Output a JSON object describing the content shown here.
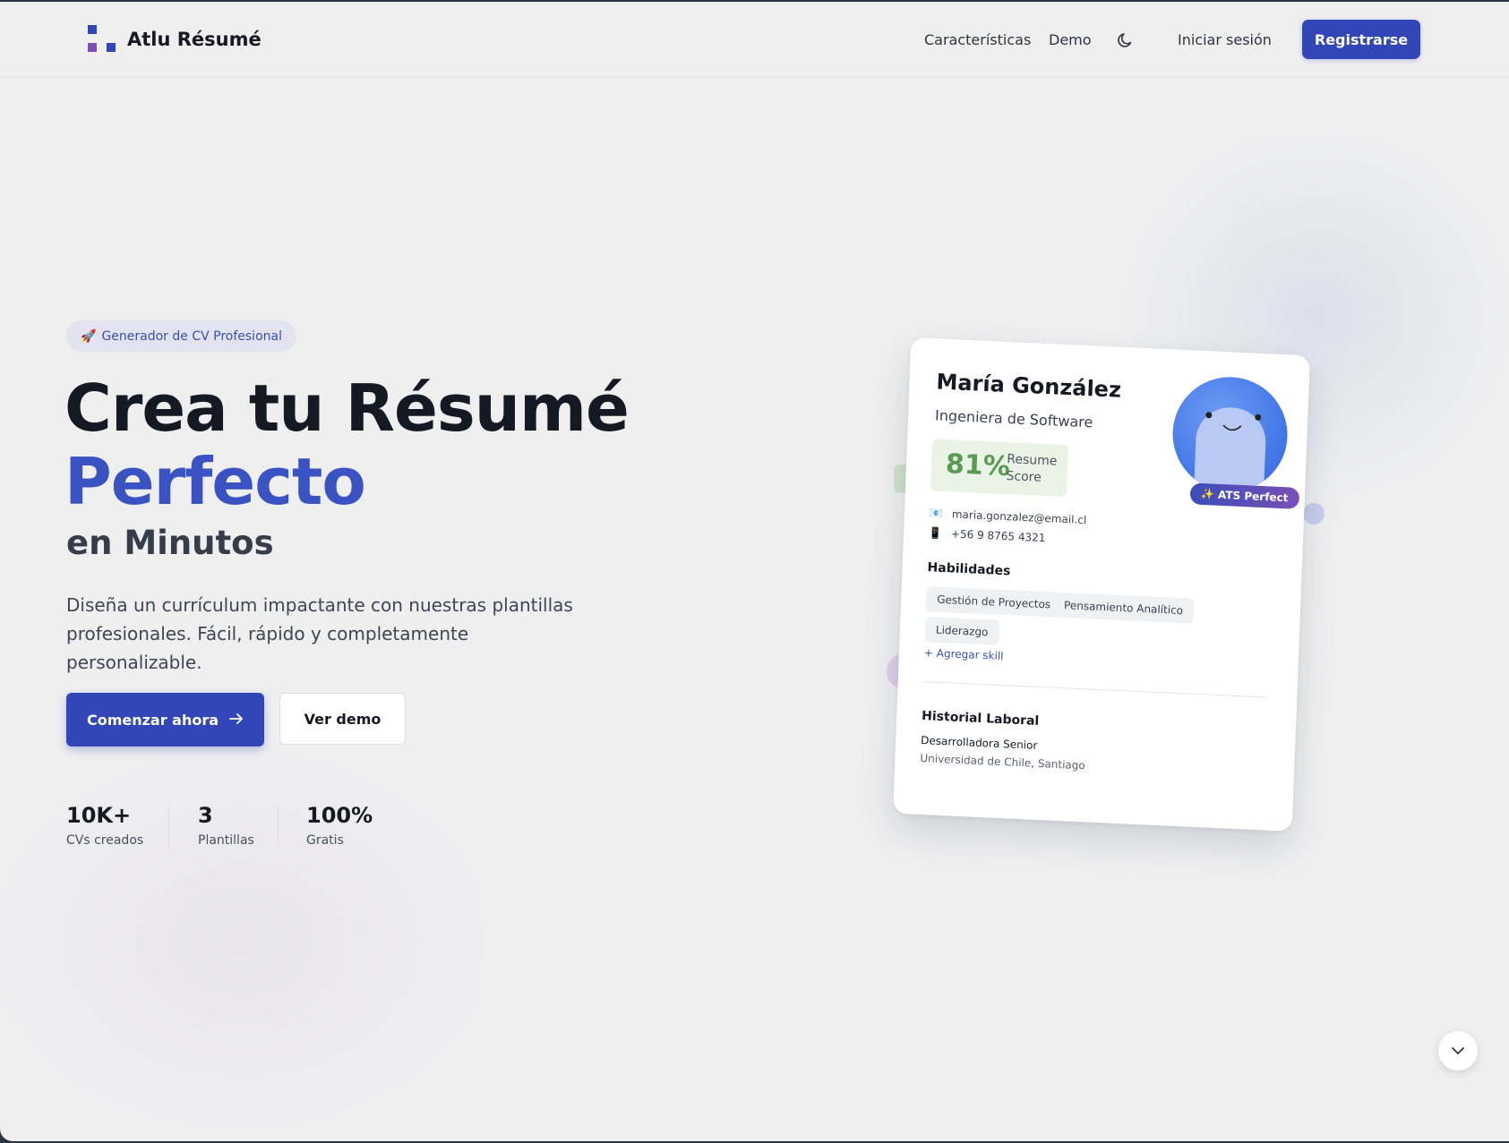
{
  "colors": {
    "primary": "#3346b8",
    "accent_text": "#3a52c2",
    "score_green": "#5a9a55",
    "logo_purple": "#7c4fb2"
  },
  "nav": {
    "brand": "Atlu Résumé",
    "links": [
      "Características",
      "Demo"
    ],
    "theme_icon": "moon-icon",
    "login": "Iniciar sesión",
    "signup": "Registrarse"
  },
  "hero": {
    "badge_icon": "🚀",
    "badge": "Generador de CV Profesional",
    "title_line1": "Crea tu Résumé",
    "title_line2": "Perfecto",
    "subtitle": "en Minutos",
    "description": "Diseña un currículum impactante con nuestras plantillas profesionales. Fácil, rápido y completamente personalizable.",
    "cta_primary": "Comenzar ahora",
    "cta_secondary": "Ver demo",
    "stats": [
      {
        "value": "10K+",
        "label": "CVs creados"
      },
      {
        "value": "3",
        "label": "Plantillas"
      },
      {
        "value": "100%",
        "label": "Gratis"
      }
    ]
  },
  "resume_card": {
    "name": "María González",
    "role": "Ingeniera de Software",
    "score_value": "81%",
    "score_label": "Resume Score",
    "ats_badge": "✨ ATS Perfect",
    "email_icon": "📧",
    "email": "maria.gonzalez@email.cl",
    "phone_icon": "📱",
    "phone": "+56 9 8765 4321",
    "skills_title": "Habilidades",
    "skills": [
      "Gestión de Proyectos",
      "Pensamiento Analítico",
      "Liderazgo"
    ],
    "add_skill": "+ Agregar skill",
    "history_title": "Historial Laboral",
    "job_title": "Desarrolladora Senior",
    "job_org": "Universidad de Chile, Santiago"
  },
  "scroll_icon": "chevron-down-icon"
}
